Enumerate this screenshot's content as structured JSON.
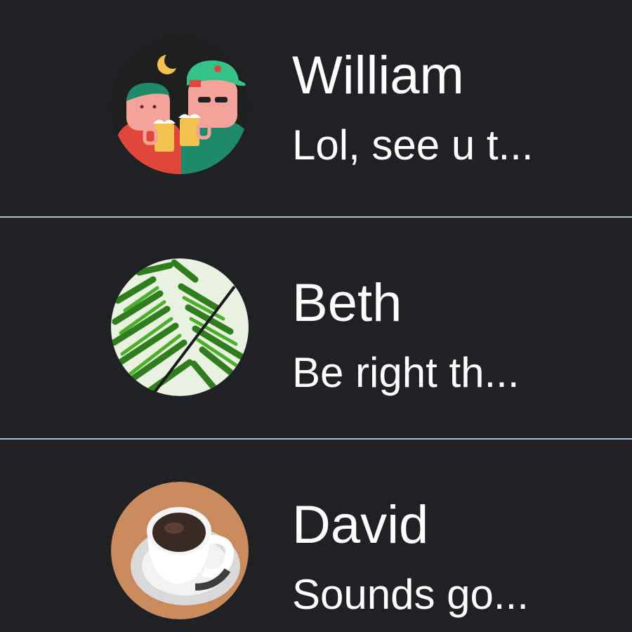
{
  "conversations": [
    {
      "name": "William",
      "preview": "Lol, see u t...",
      "avatar_icon": "friends-toasting-beer-icon"
    },
    {
      "name": "Beth",
      "preview": "Be right th...",
      "avatar_icon": "fern-leaf-icon"
    },
    {
      "name": "David",
      "preview": "Sounds go...",
      "avatar_icon": "coffee-cup-icon"
    }
  ],
  "colors": {
    "background": "#202124",
    "divider": "#a6c3d6",
    "text": "#ffffff"
  }
}
